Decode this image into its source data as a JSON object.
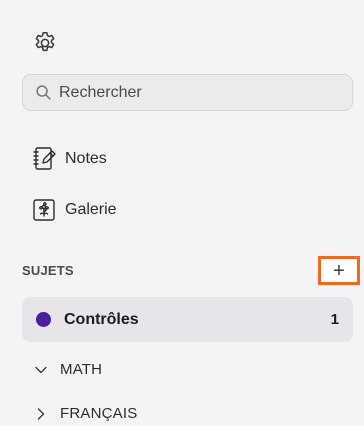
{
  "search": {
    "placeholder": "Rechercher"
  },
  "nav": {
    "notes": "Notes",
    "galerie": "Galerie"
  },
  "sujets": {
    "label": "SUJETS",
    "add_label": "+",
    "accent": "#f06a1d"
  },
  "subjects": [
    {
      "name": "Contrôles",
      "count": "1",
      "color": "#4a1f9e"
    }
  ],
  "folders": [
    {
      "name": "MATH",
      "state": "expanded"
    },
    {
      "name": "FRANÇAIS",
      "state": "collapsed"
    }
  ]
}
